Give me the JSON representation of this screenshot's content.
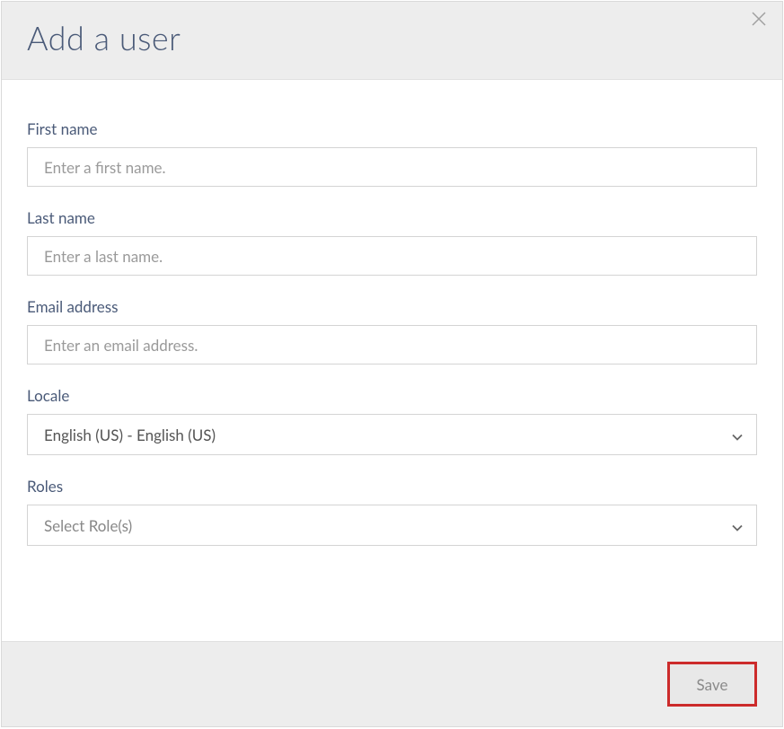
{
  "header": {
    "title": "Add a user"
  },
  "form": {
    "first_name": {
      "label": "First name",
      "placeholder": "Enter a first name.",
      "value": ""
    },
    "last_name": {
      "label": "Last name",
      "placeholder": "Enter a last name.",
      "value": ""
    },
    "email": {
      "label": "Email address",
      "placeholder": "Enter an email address.",
      "value": ""
    },
    "locale": {
      "label": "Locale",
      "selected": "English (US) - English (US)"
    },
    "roles": {
      "label": "Roles",
      "placeholder": "Select Role(s)"
    }
  },
  "footer": {
    "save_label": "Save"
  }
}
